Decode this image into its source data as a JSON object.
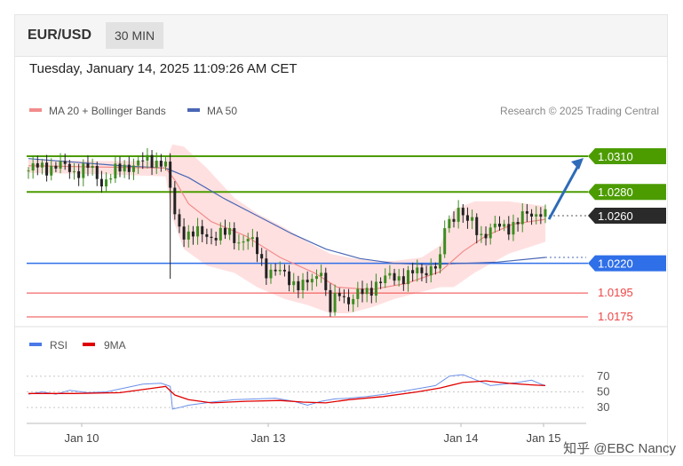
{
  "header": {
    "symbol": "EUR/USD",
    "timeframe": "30 MIN"
  },
  "timestamp": "Tuesday, January 14, 2025 11:09:26 AM CET",
  "legend": {
    "ma20": "MA 20 + Bollinger Bands",
    "ma50": "MA 50"
  },
  "credit": "Research © 2025 Trading Central",
  "watermark": "知乎 @EBC Nancy",
  "colors": {
    "green": "#4c9c00",
    "blue": "#2f6fe8",
    "red": "#ef4444",
    "dark": "#2a2a2a",
    "ma20": "#f28b8b",
    "ma50": "#4a67b5",
    "band": "#ffd6d6",
    "arrow": "#2e6bb8"
  },
  "chart_data": [
    {
      "type": "candlestick",
      "x_labels": [
        "Jan 10",
        "Jan 13",
        "Jan 14",
        "Jan 15"
      ],
      "y_range": [
        1.017,
        1.0335
      ],
      "levels": [
        {
          "value": 1.031,
          "label": "1.0310",
          "kind": "resistance"
        },
        {
          "value": 1.028,
          "label": "1.0280",
          "kind": "resistance"
        },
        {
          "value": 1.026,
          "label": "1.0260",
          "kind": "last"
        },
        {
          "value": 1.022,
          "label": "1.0220",
          "kind": "pivot"
        },
        {
          "value": 1.0195,
          "label": "1.0195",
          "kind": "support"
        },
        {
          "value": 1.0175,
          "label": "1.0175",
          "kind": "support"
        }
      ],
      "price_path": [
        [
          0,
          1.0298
        ],
        [
          6,
          1.0301
        ],
        [
          12,
          1.0302
        ],
        [
          20,
          1.0298
        ],
        [
          26,
          1.03
        ],
        [
          32,
          1.0289
        ],
        [
          38,
          1.0296
        ],
        [
          45,
          1.0304
        ],
        [
          52,
          1.0305
        ],
        [
          58,
          1.0307
        ],
        [
          60,
          1.0302
        ],
        [
          62,
          1.028
        ],
        [
          64,
          1.026
        ],
        [
          66,
          1.025
        ],
        [
          70,
          1.0245
        ],
        [
          75,
          1.0244
        ],
        [
          82,
          1.0244
        ],
        [
          88,
          1.0244
        ],
        [
          92,
          1.024
        ],
        [
          96,
          1.024
        ],
        [
          100,
          1.023
        ],
        [
          104,
          1.0215
        ],
        [
          108,
          1.0212
        ],
        [
          112,
          1.021
        ],
        [
          116,
          1.0205
        ],
        [
          120,
          1.02
        ],
        [
          124,
          1.0205
        ],
        [
          128,
          1.0218
        ],
        [
          130,
          1.0195
        ],
        [
          132,
          1.018
        ],
        [
          136,
          1.0195
        ],
        [
          140,
          1.019
        ],
        [
          144,
          1.0193
        ],
        [
          148,
          1.0195
        ],
        [
          152,
          1.0205
        ],
        [
          156,
          1.0206
        ],
        [
          160,
          1.0208
        ],
        [
          164,
          1.021
        ],
        [
          168,
          1.0211
        ],
        [
          172,
          1.0212
        ],
        [
          176,
          1.0218
        ],
        [
          180,
          1.022
        ],
        [
          182,
          1.025
        ],
        [
          186,
          1.026
        ],
        [
          188,
          1.027
        ],
        [
          190,
          1.0258
        ],
        [
          194,
          1.0252
        ],
        [
          198,
          1.0245
        ],
        [
          202,
          1.0248
        ],
        [
          206,
          1.025
        ],
        [
          210,
          1.0252
        ],
        [
          214,
          1.0255
        ],
        [
          218,
          1.026
        ],
        [
          222,
          1.0263
        ],
        [
          224,
          1.0265
        ],
        [
          226,
          1.026
        ]
      ],
      "ma20": [
        [
          0,
          1.0302
        ],
        [
          30,
          1.0301
        ],
        [
          60,
          1.03
        ],
        [
          64,
          1.029
        ],
        [
          70,
          1.027
        ],
        [
          80,
          1.0255
        ],
        [
          95,
          1.0243
        ],
        [
          110,
          1.0225
        ],
        [
          125,
          1.0212
        ],
        [
          135,
          1.02
        ],
        [
          150,
          1.0198
        ],
        [
          165,
          1.0203
        ],
        [
          180,
          1.0213
        ],
        [
          190,
          1.023
        ],
        [
          200,
          1.0243
        ],
        [
          212,
          1.0253
        ],
        [
          226,
          1.0257
        ]
      ],
      "ma50": [
        [
          0,
          1.0308
        ],
        [
          20,
          1.0305
        ],
        [
          40,
          1.0302
        ],
        [
          60,
          1.03
        ],
        [
          70,
          1.0292
        ],
        [
          85,
          1.0275
        ],
        [
          100,
          1.026
        ],
        [
          115,
          1.0245
        ],
        [
          130,
          1.0232
        ],
        [
          145,
          1.0224
        ],
        [
          160,
          1.022
        ],
        [
          175,
          1.0219
        ],
        [
          190,
          1.022
        ],
        [
          205,
          1.0221
        ],
        [
          226,
          1.0225
        ]
      ],
      "bb_upper": [
        [
          0,
          1.0307
        ],
        [
          30,
          1.0306
        ],
        [
          60,
          1.0306
        ],
        [
          63,
          1.032
        ],
        [
          68,
          1.0318
        ],
        [
          78,
          1.03
        ],
        [
          90,
          1.0275
        ],
        [
          100,
          1.0262
        ],
        [
          112,
          1.025
        ],
        [
          122,
          1.0238
        ],
        [
          132,
          1.0228
        ],
        [
          140,
          1.0225
        ],
        [
          150,
          1.0222
        ],
        [
          160,
          1.0222
        ],
        [
          172,
          1.0225
        ],
        [
          180,
          1.0235
        ],
        [
          186,
          1.0265
        ],
        [
          195,
          1.0272
        ],
        [
          210,
          1.0272
        ],
        [
          226,
          1.0268
        ]
      ],
      "bb_lower": [
        [
          0,
          1.0296
        ],
        [
          30,
          1.0295
        ],
        [
          60,
          1.0293
        ],
        [
          63,
          1.0258
        ],
        [
          68,
          1.0232
        ],
        [
          78,
          1.0218
        ],
        [
          90,
          1.0212
        ],
        [
          100,
          1.02
        ],
        [
          112,
          1.019
        ],
        [
          122,
          1.0185
        ],
        [
          132,
          1.0178
        ],
        [
          140,
          1.0178
        ],
        [
          150,
          1.0183
        ],
        [
          160,
          1.019
        ],
        [
          172,
          1.0196
        ],
        [
          180,
          1.02
        ],
        [
          186,
          1.02
        ],
        [
          195,
          1.0212
        ],
        [
          210,
          1.0228
        ],
        [
          226,
          1.0238
        ]
      ],
      "projection": {
        "from": 1.0257,
        "to": 1.031
      }
    },
    {
      "type": "line",
      "legend": [
        "RSI",
        "9MA"
      ],
      "y_ticks": [
        70,
        50,
        30
      ],
      "y_range": [
        20,
        80
      ],
      "rsi": [
        [
          0,
          47
        ],
        [
          6,
          50
        ],
        [
          12,
          47
        ],
        [
          18,
          52
        ],
        [
          26,
          49
        ],
        [
          34,
          50
        ],
        [
          42,
          55
        ],
        [
          50,
          60
        ],
        [
          58,
          61
        ],
        [
          62,
          57
        ],
        [
          63,
          28
        ],
        [
          66,
          30
        ],
        [
          70,
          33
        ],
        [
          80,
          37
        ],
        [
          90,
          40
        ],
        [
          100,
          41
        ],
        [
          108,
          42
        ],
        [
          116,
          38
        ],
        [
          122,
          33
        ],
        [
          128,
          38
        ],
        [
          134,
          41
        ],
        [
          140,
          42
        ],
        [
          148,
          44
        ],
        [
          156,
          47
        ],
        [
          164,
          51
        ],
        [
          172,
          55
        ],
        [
          178,
          58
        ],
        [
          184,
          70
        ],
        [
          190,
          72
        ],
        [
          196,
          65
        ],
        [
          202,
          58
        ],
        [
          208,
          60
        ],
        [
          214,
          62
        ],
        [
          220,
          65
        ],
        [
          224,
          60
        ],
        [
          226,
          58
        ]
      ],
      "ma9": [
        [
          0,
          48
        ],
        [
          20,
          48
        ],
        [
          40,
          49
        ],
        [
          55,
          55
        ],
        [
          60,
          57
        ],
        [
          64,
          46
        ],
        [
          70,
          40
        ],
        [
          80,
          36
        ],
        [
          95,
          38
        ],
        [
          110,
          39
        ],
        [
          120,
          37
        ],
        [
          130,
          36
        ],
        [
          140,
          40
        ],
        [
          155,
          44
        ],
        [
          170,
          50
        ],
        [
          180,
          55
        ],
        [
          190,
          62
        ],
        [
          200,
          64
        ],
        [
          210,
          61
        ],
        [
          220,
          59
        ],
        [
          226,
          58
        ]
      ]
    }
  ]
}
